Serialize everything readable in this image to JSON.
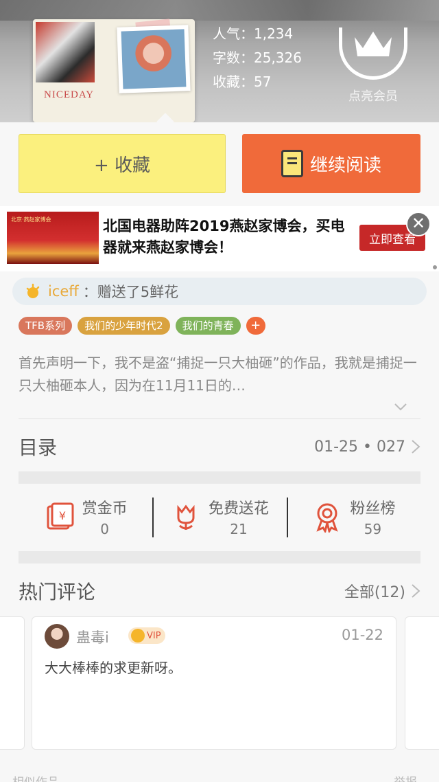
{
  "header": {
    "cover_text": "NICEDAY",
    "stats": [
      {
        "label": "人气：",
        "value": "1,234"
      },
      {
        "label": "字数：",
        "value": "25,326"
      },
      {
        "label": "收藏：",
        "value": "57"
      }
    ],
    "member_label": "点亮会员"
  },
  "actions": {
    "collect_label": "+ 收藏",
    "read_label": "继续阅读"
  },
  "ad": {
    "thumb_tag": "北京·燕赵家博会",
    "text": "北国电器助阵2019燕赵家博会，买电器就来燕赵家博会！",
    "button_label": "立即查看",
    "close_symbol": "✕"
  },
  "notice": {
    "user": "iceff",
    "message": "：赠送了5鲜花"
  },
  "tags": [
    {
      "label": "TFB系列",
      "color": "#d9775c"
    },
    {
      "label": "我们的少年时代2",
      "color": "#d9a23f"
    },
    {
      "label": "我们的青春",
      "color": "#7fb35a"
    }
  ],
  "tag_add_symbol": "+",
  "description": "首先声明一下，我不是盗“捕捉一只大柚砸”的作品，我就是捕捉一只大柚砸本人，因为在11月11日的…",
  "catalog": {
    "title": "目录",
    "meta": "01-25 • 027"
  },
  "stats_row": [
    {
      "label": "赏金币",
      "value": "0",
      "icon": "red-envelope-icon"
    },
    {
      "label": "免费送花",
      "value": "21",
      "icon": "flower-icon"
    },
    {
      "label": "粉丝榜",
      "value": "59",
      "icon": "medal-icon"
    }
  ],
  "hot_comments": {
    "title": "热门评论",
    "all_label": "全部(12)",
    "items": [
      {
        "user": "蛊毒i",
        "badge": "VIP",
        "date": "01-22",
        "body": "大大棒棒的求更新呀。"
      }
    ]
  },
  "footer": {
    "left": "相似作品",
    "right": "举报"
  },
  "colors": {
    "accent_orange": "#f06a3a",
    "collect_yellow": "#fbf07e",
    "icon_red": "#e0533c"
  }
}
